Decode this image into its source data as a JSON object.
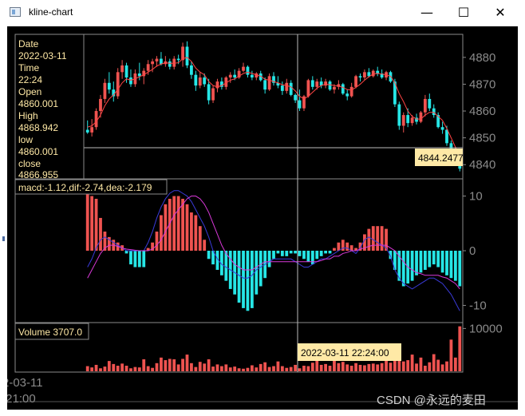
{
  "window": {
    "title": "kline-chart",
    "minimize_glyph": "—",
    "maximize_glyph": "☐",
    "close_glyph": "✕"
  },
  "info_box": {
    "date_label": "Date",
    "date": "2022-03-11",
    "time_label": "Time",
    "time": "22:24",
    "open_label": "Open",
    "open": "4860.001",
    "high_label": "High",
    "high": "4868.942",
    "low_label": "low",
    "low": "4860.001",
    "close_label": "close",
    "close": "4866.955"
  },
  "crosshair": {
    "price_label": "4844.2477",
    "time_label": "2022-03-11 22:24:00"
  },
  "macd_legend": "macd:-1.12,dif:-2.74,dea:-2.179",
  "volume_legend": "Volume 3707.0",
  "bottom_axis": {
    "date": "2-03-11",
    "time": ":21:00"
  },
  "watermark": "CSDN @永远的麦田",
  "colors": {
    "up": "#ef5350",
    "down": "#26e6e6",
    "grid": "#8a8a8a",
    "dif": "#3a3ad8",
    "dea": "#d838d8",
    "ma": "#ff4444",
    "info_bg": "#ffe9a6"
  },
  "chart_data": [
    {
      "type": "candlestick",
      "ylim": [
        4835,
        4888
      ],
      "yticks": [
        4840,
        4850,
        4860,
        4870,
        4880
      ],
      "ohlc": [
        [
          4853.0,
          4856.5,
          4851.5,
          4852.0
        ],
        [
          4852.0,
          4857.0,
          4850.5,
          4854.0
        ],
        [
          4854.0,
          4861.0,
          4853.0,
          4860.0
        ],
        [
          4860.0,
          4866.0,
          4857.5,
          4864.5
        ],
        [
          4864.5,
          4872.0,
          4863.0,
          4870.5
        ],
        [
          4870.5,
          4874.5,
          4866.5,
          4868.0
        ],
        [
          4868.0,
          4871.0,
          4863.5,
          4865.5
        ],
        [
          4865.5,
          4876.0,
          4864.5,
          4874.5
        ],
        [
          4874.5,
          4879.0,
          4872.0,
          4877.0
        ],
        [
          4877.0,
          4878.0,
          4870.5,
          4872.5
        ],
        [
          4872.5,
          4875.5,
          4869.0,
          4870.0
        ],
        [
          4870.0,
          4875.5,
          4869.0,
          4874.0
        ],
        [
          4874.0,
          4878.0,
          4871.5,
          4873.0
        ],
        [
          4873.0,
          4876.0,
          4870.0,
          4875.0
        ],
        [
          4875.0,
          4879.0,
          4873.5,
          4877.5
        ],
        [
          4877.5,
          4879.5,
          4874.5,
          4878.5
        ],
        [
          4878.5,
          4880.5,
          4876.5,
          4879.5
        ],
        [
          4879.5,
          4882.0,
          4877.0,
          4877.5
        ],
        [
          4877.5,
          4880.5,
          4876.5,
          4878.5
        ],
        [
          4878.5,
          4879.5,
          4875.5,
          4876.5
        ],
        [
          4876.5,
          4880.5,
          4875.5,
          4879.5
        ],
        [
          4879.5,
          4881.0,
          4877.5,
          4879.0
        ],
        [
          4879.0,
          4885.5,
          4876.5,
          4884.0
        ],
        [
          4884.0,
          4886.0,
          4876.0,
          4877.0
        ],
        [
          4877.0,
          4878.5,
          4872.0,
          4873.5
        ],
        [
          4873.5,
          4875.0,
          4867.5,
          4869.5
        ],
        [
          4869.5,
          4874.5,
          4868.5,
          4872.5
        ],
        [
          4872.5,
          4874.0,
          4869.0,
          4870.0
        ],
        [
          4870.0,
          4872.0,
          4862.5,
          4864.0
        ],
        [
          4864.0,
          4869.5,
          4863.0,
          4868.5
        ],
        [
          4868.5,
          4872.0,
          4867.0,
          4871.0
        ],
        [
          4871.0,
          4872.5,
          4868.0,
          4869.0
        ],
        [
          4869.0,
          4873.0,
          4868.0,
          4872.5
        ],
        [
          4872.5,
          4874.5,
          4870.5,
          4873.5
        ],
        [
          4873.5,
          4875.5,
          4871.5,
          4872.5
        ],
        [
          4872.5,
          4876.0,
          4872.0,
          4875.0
        ],
        [
          4875.0,
          4878.0,
          4874.5,
          4876.5
        ],
        [
          4876.5,
          4877.0,
          4872.5,
          4873.5
        ],
        [
          4873.5,
          4875.0,
          4871.5,
          4872.5
        ],
        [
          4872.5,
          4874.5,
          4871.5,
          4874.0
        ],
        [
          4874.0,
          4875.0,
          4871.0,
          4871.5
        ],
        [
          4871.5,
          4872.5,
          4866.5,
          4868.0
        ],
        [
          4868.0,
          4874.0,
          4867.5,
          4873.0
        ],
        [
          4873.0,
          4874.5,
          4869.5,
          4870.5
        ],
        [
          4870.5,
          4873.0,
          4868.5,
          4869.5
        ],
        [
          4869.5,
          4871.0,
          4866.0,
          4867.5
        ],
        [
          4867.5,
          4872.0,
          4866.5,
          4870.5
        ],
        [
          4870.5,
          4871.5,
          4865.5,
          4866.0
        ],
        [
          4866.0,
          4866.5,
          4863.0,
          4864.0
        ],
        [
          4864.0,
          4868.0,
          4860.0,
          4861.0
        ],
        [
          4861.0,
          4866.0,
          4860.0,
          4865.5
        ],
        [
          4865.5,
          4872.0,
          4865.0,
          4871.5
        ],
        [
          4871.5,
          4873.0,
          4868.0,
          4869.0
        ],
        [
          4869.0,
          4872.0,
          4868.0,
          4871.0
        ],
        [
          4871.0,
          4872.5,
          4868.5,
          4869.5
        ],
        [
          4869.5,
          4872.0,
          4868.5,
          4871.0
        ],
        [
          4871.0,
          4871.5,
          4867.5,
          4868.0
        ],
        [
          4868.0,
          4870.0,
          4866.5,
          4869.0
        ],
        [
          4869.0,
          4871.5,
          4868.0,
          4870.0
        ],
        [
          4870.0,
          4870.5,
          4866.0,
          4866.5
        ],
        [
          4866.5,
          4868.0,
          4864.0,
          4865.5
        ],
        [
          4865.5,
          4870.5,
          4865.0,
          4869.0
        ],
        [
          4869.0,
          4873.5,
          4868.5,
          4873.0
        ],
        [
          4873.0,
          4874.0,
          4871.0,
          4872.5
        ],
        [
          4872.5,
          4875.5,
          4871.5,
          4874.5
        ],
        [
          4874.5,
          4876.0,
          4872.5,
          4873.0
        ],
        [
          4873.0,
          4875.5,
          4872.5,
          4875.0
        ],
        [
          4875.0,
          4876.5,
          4873.0,
          4874.0
        ],
        [
          4874.0,
          4875.5,
          4872.0,
          4872.5
        ],
        [
          4872.5,
          4875.0,
          4871.5,
          4874.5
        ],
        [
          4874.5,
          4875.0,
          4870.5,
          4871.0
        ],
        [
          4871.0,
          4872.0,
          4861.5,
          4862.5
        ],
        [
          4862.5,
          4863.5,
          4853.0,
          4854.5
        ],
        [
          4854.5,
          4859.5,
          4852.0,
          4858.5
        ],
        [
          4858.5,
          4861.0,
          4854.0,
          4855.5
        ],
        [
          4855.5,
          4858.5,
          4854.5,
          4857.5
        ],
        [
          4857.5,
          4859.0,
          4855.0,
          4856.0
        ],
        [
          4856.0,
          4860.0,
          4855.5,
          4859.5
        ],
        [
          4859.5,
          4866.0,
          4858.0,
          4864.5
        ],
        [
          4864.5,
          4866.5,
          4860.0,
          4861.0
        ],
        [
          4861.0,
          4862.5,
          4857.5,
          4858.5
        ],
        [
          4858.5,
          4859.5,
          4853.5,
          4854.0
        ],
        [
          4854.0,
          4856.0,
          4851.5,
          4853.0
        ],
        [
          4853.0,
          4854.5,
          4847.0,
          4848.0
        ],
        [
          4848.0,
          4849.0,
          4843.0,
          4844.0
        ],
        [
          4844.0,
          4846.5,
          4840.5,
          4841.5
        ],
        [
          4841.5,
          4843.0,
          4837.5,
          4838.5
        ]
      ],
      "ma": [
        4854.0,
        4854.5,
        4856.0,
        4858.5,
        4862.0,
        4864.5,
        4866.0,
        4868.0,
        4870.5,
        4872.0,
        4871.5,
        4872.0,
        4872.8,
        4873.5,
        4874.5,
        4875.5,
        4876.8,
        4877.5,
        4878.0,
        4877.8,
        4877.8,
        4878.0,
        4879.5,
        4880.0,
        4878.5,
        4876.0,
        4874.5,
        4873.5,
        4871.0,
        4869.5,
        4869.0,
        4869.5,
        4870.5,
        4871.5,
        4872.0,
        4873.0,
        4874.0,
        4874.5,
        4874.0,
        4873.5,
        4873.0,
        4871.8,
        4871.5,
        4871.0,
        4870.5,
        4869.8,
        4869.5,
        4869.0,
        4867.5,
        4865.5,
        4864.5,
        4865.5,
        4867.0,
        4868.5,
        4869.5,
        4870.0,
        4869.8,
        4869.5,
        4869.3,
        4868.8,
        4868.0,
        4867.8,
        4868.8,
        4870.0,
        4871.5,
        4872.8,
        4873.8,
        4874.0,
        4873.8,
        4873.5,
        4873.0,
        4870.5,
        4866.5,
        4863.5,
        4860.0,
        4858.0,
        4857.0,
        4857.0,
        4858.5,
        4859.5,
        4859.5,
        4858.0,
        4856.5,
        4853.5,
        4850.0,
        4846.5,
        4843.0
      ]
    },
    {
      "type": "bar",
      "name": "macd",
      "ylim": [
        -13,
        13
      ],
      "yticks": [
        -10,
        0,
        10
      ],
      "macd": [
        10.5,
        10.0,
        9.5,
        6.0,
        3.5,
        2.5,
        2.0,
        1.5,
        1.0,
        -0.5,
        -2.5,
        -3.0,
        -3.0,
        -3.0,
        0.5,
        1.5,
        3.5,
        6.5,
        8.5,
        9.5,
        10.0,
        10.0,
        9.5,
        8.5,
        7.0,
        6.5,
        4.5,
        2.0,
        -1.5,
        -2.5,
        -3.5,
        -4.5,
        -5.5,
        -7.0,
        -8.0,
        -9.5,
        -10.5,
        -11.0,
        -10.5,
        -8.0,
        -6.5,
        -5.0,
        -3.0,
        -1.5,
        -0.5,
        -1.0,
        -1.0,
        -0.5,
        -0.5,
        -1.0,
        -1.5,
        -2.0,
        -2.5,
        -1.5,
        -1.0,
        -0.5,
        -0.5,
        0.5,
        1.5,
        2.0,
        1.5,
        1.0,
        0.5,
        1.5,
        3.0,
        4.0,
        4.5,
        4.5,
        4.5,
        4.0,
        -1.5,
        -3.5,
        -5.5,
        -6.5,
        -6.0,
        -5.5,
        -4.5,
        -4.0,
        -3.5,
        -3.0,
        -2.5,
        -3.0,
        -4.0,
        -4.5,
        -5.0,
        -5.5,
        -6.5
      ],
      "dif": [
        -3.0,
        -1.5,
        0.5,
        2.0,
        2.5,
        2.0,
        1.5,
        1.0,
        0.5,
        0.0,
        0.0,
        0.0,
        0.0,
        0.0,
        1.5,
        3.5,
        6.0,
        8.0,
        9.5,
        10.5,
        11.0,
        11.0,
        10.5,
        10.0,
        9.0,
        7.5,
        6.0,
        4.5,
        2.5,
        0.0,
        -1.5,
        -2.5,
        -3.0,
        -3.5,
        -4.0,
        -4.5,
        -5.0,
        -5.0,
        -4.5,
        -3.5,
        -3.0,
        -2.5,
        -2.0,
        -1.5,
        -1.5,
        -1.5,
        -1.5,
        -1.5,
        -2.0,
        -2.5,
        -3.0,
        -3.0,
        -2.5,
        -2.0,
        -1.5,
        -1.5,
        -1.0,
        -0.5,
        0.0,
        0.5,
        0.5,
        0.0,
        -0.5,
        0.5,
        2.0,
        2.5,
        2.0,
        1.5,
        1.0,
        0.5,
        -1.0,
        -3.5,
        -5.0,
        -6.0,
        -6.5,
        -7.0,
        -6.5,
        -6.0,
        -5.5,
        -5.0,
        -5.0,
        -5.5,
        -6.0,
        -7.0,
        -8.0,
        -9.5,
        -11.0
      ],
      "dea": [
        -5.0,
        -3.5,
        -2.0,
        -0.5,
        0.5,
        1.0,
        1.0,
        0.8,
        0.5,
        0.3,
        0.2,
        0.1,
        0.0,
        0.0,
        0.0,
        0.3,
        1.0,
        2.0,
        3.5,
        5.0,
        6.5,
        7.5,
        8.5,
        9.5,
        10.0,
        10.0,
        9.5,
        8.5,
        7.0,
        5.0,
        3.0,
        1.0,
        -0.5,
        -1.5,
        -2.5,
        -3.0,
        -3.5,
        -3.5,
        -3.5,
        -3.0,
        -2.5,
        -2.0,
        -2.0,
        -2.0,
        -2.0,
        -2.0,
        -2.0,
        -2.0,
        -2.0,
        -2.0,
        -2.0,
        -2.0,
        -2.0,
        -2.0,
        -1.8,
        -1.5,
        -1.5,
        -1.0,
        -1.0,
        -0.5,
        -0.3,
        0.0,
        0.0,
        0.3,
        0.5,
        0.8,
        1.0,
        1.0,
        1.0,
        1.0,
        0.5,
        0.0,
        -1.0,
        -2.0,
        -3.0,
        -3.5,
        -4.0,
        -4.2,
        -4.5,
        -4.5,
        -4.5,
        -4.5,
        -4.8,
        -5.0,
        -5.5,
        -6.0,
        -7.0
      ]
    },
    {
      "type": "bar",
      "name": "volume",
      "ylim": [
        0,
        11000
      ],
      "yticks": [
        10000
      ],
      "volume": [
        1200,
        900,
        1500,
        700,
        1100,
        2400,
        1700,
        1300,
        1800,
        1300,
        700,
        1000,
        900,
        2800,
        1200,
        800,
        1900,
        3200,
        2600,
        2900,
        2800,
        1600,
        2900,
        3900,
        1900,
        1000,
        2200,
        1800,
        2800,
        1100,
        1600,
        1200,
        1600,
        900,
        1100,
        700,
        600,
        800,
        1400,
        900,
        1700,
        2100,
        1000,
        1200,
        2300,
        1200,
        800,
        1000,
        1500,
        700,
        1300,
        1200,
        2000,
        3100,
        1500,
        1700,
        1300,
        3700,
        1900,
        2200,
        1600,
        1300,
        1900,
        1500,
        1400,
        1700,
        1800,
        1600,
        1900,
        2600,
        2000,
        3500,
        5600,
        2300,
        2600,
        3900,
        1800,
        3200,
        1300,
        2100,
        4000,
        2700,
        1600,
        2300,
        7400,
        3200,
        10500
      ]
    }
  ]
}
